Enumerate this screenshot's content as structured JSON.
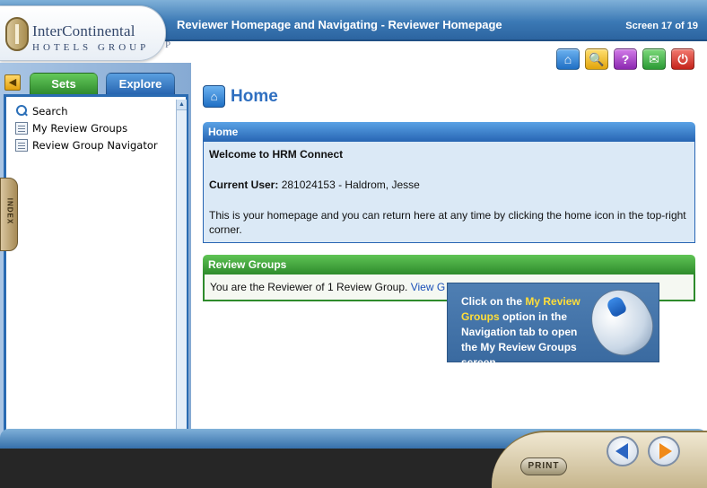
{
  "header": {
    "logo_line1": "InterContinental",
    "logo_line2": "HOTELS GROUP",
    "logo_tail": "P",
    "title": "Reviewer Homepage and Navigating - Reviewer Homepage",
    "screen_counter": "Screen 17 of 19"
  },
  "toolbar": {
    "buttons": [
      {
        "name": "home-icon",
        "glyph": "⌂"
      },
      {
        "name": "search-icon",
        "glyph": "🔍"
      },
      {
        "name": "help-icon",
        "glyph": "?"
      },
      {
        "name": "mail-icon",
        "glyph": "✉"
      },
      {
        "name": "exit-icon",
        "glyph": "⏻"
      }
    ]
  },
  "sidebar": {
    "collapse_glyph": "◀",
    "tabs": [
      {
        "label": "Sets"
      },
      {
        "label": "Explore"
      }
    ],
    "items": [
      {
        "label": "Search"
      },
      {
        "label": "My Review Groups"
      },
      {
        "label": "Review Group Navigator"
      }
    ],
    "scroll_glyph": "▲",
    "index_label": "INDEX"
  },
  "main": {
    "page_title": "Home",
    "home_panel": {
      "header": "Home",
      "welcome": "Welcome to HRM Connect",
      "current_user_label": "Current User:",
      "current_user_value": "281024153 - Haldrom, Jesse",
      "info": "This is your homepage and you can return here at any time by clicking the home icon in the top-right corner."
    },
    "review_groups_panel": {
      "header": "Review Groups",
      "text": "You are the Reviewer of 1 Review Group.",
      "link": "View G"
    }
  },
  "callout": {
    "text_before": "Click on the ",
    "highlight": "My Review Groups",
    "text_after": " option in the Navigation tab to open the My Review Groups screen."
  },
  "footer": {
    "print_label": "PRINT"
  },
  "colors": {
    "accent_blue": "#2f6fc0",
    "header_blue": "#3b79b5",
    "green": "#2e8b2c",
    "callout_highlight": "#ffde3a"
  }
}
